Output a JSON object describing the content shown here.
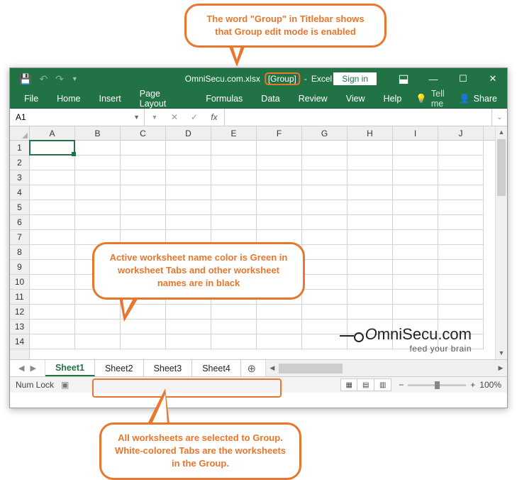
{
  "callouts": {
    "top": "The word \"Group\" in Titlebar shows that Group edit mode is enabled",
    "mid": "Active worksheet name color is Green in worksheet Tabs and other worksheet names are in black",
    "bot": "All worksheets are selected to Group. White-colored Tabs are the worksheets in the Group."
  },
  "titlebar": {
    "filename": "OmniSecu.com.xlsx",
    "group": "[Group]",
    "appname": "Excel",
    "signin": "Sign in",
    "dash": "-"
  },
  "ribbon": {
    "tabs": [
      "File",
      "Home",
      "Insert",
      "Page Layout",
      "Formulas",
      "Data",
      "Review",
      "View",
      "Help"
    ],
    "tellme": "Tell me",
    "share": "Share"
  },
  "fxrow": {
    "namebox": "A1",
    "fx": "fx"
  },
  "grid": {
    "cols": [
      "A",
      "B",
      "C",
      "D",
      "E",
      "F",
      "G",
      "H",
      "I",
      "J"
    ],
    "rows": [
      "1",
      "2",
      "3",
      "4",
      "5",
      "6",
      "7",
      "8",
      "9",
      "10",
      "11",
      "12",
      "13",
      "14"
    ]
  },
  "logo": {
    "main": "mniSecu.com",
    "sub": "feed your brain"
  },
  "sheets": {
    "tabs": [
      "Sheet1",
      "Sheet2",
      "Sheet3",
      "Sheet4"
    ],
    "add": "⊕"
  },
  "statusbar": {
    "numlock": "Num Lock",
    "zoom": "100%",
    "minus": "−",
    "plus": "+"
  }
}
